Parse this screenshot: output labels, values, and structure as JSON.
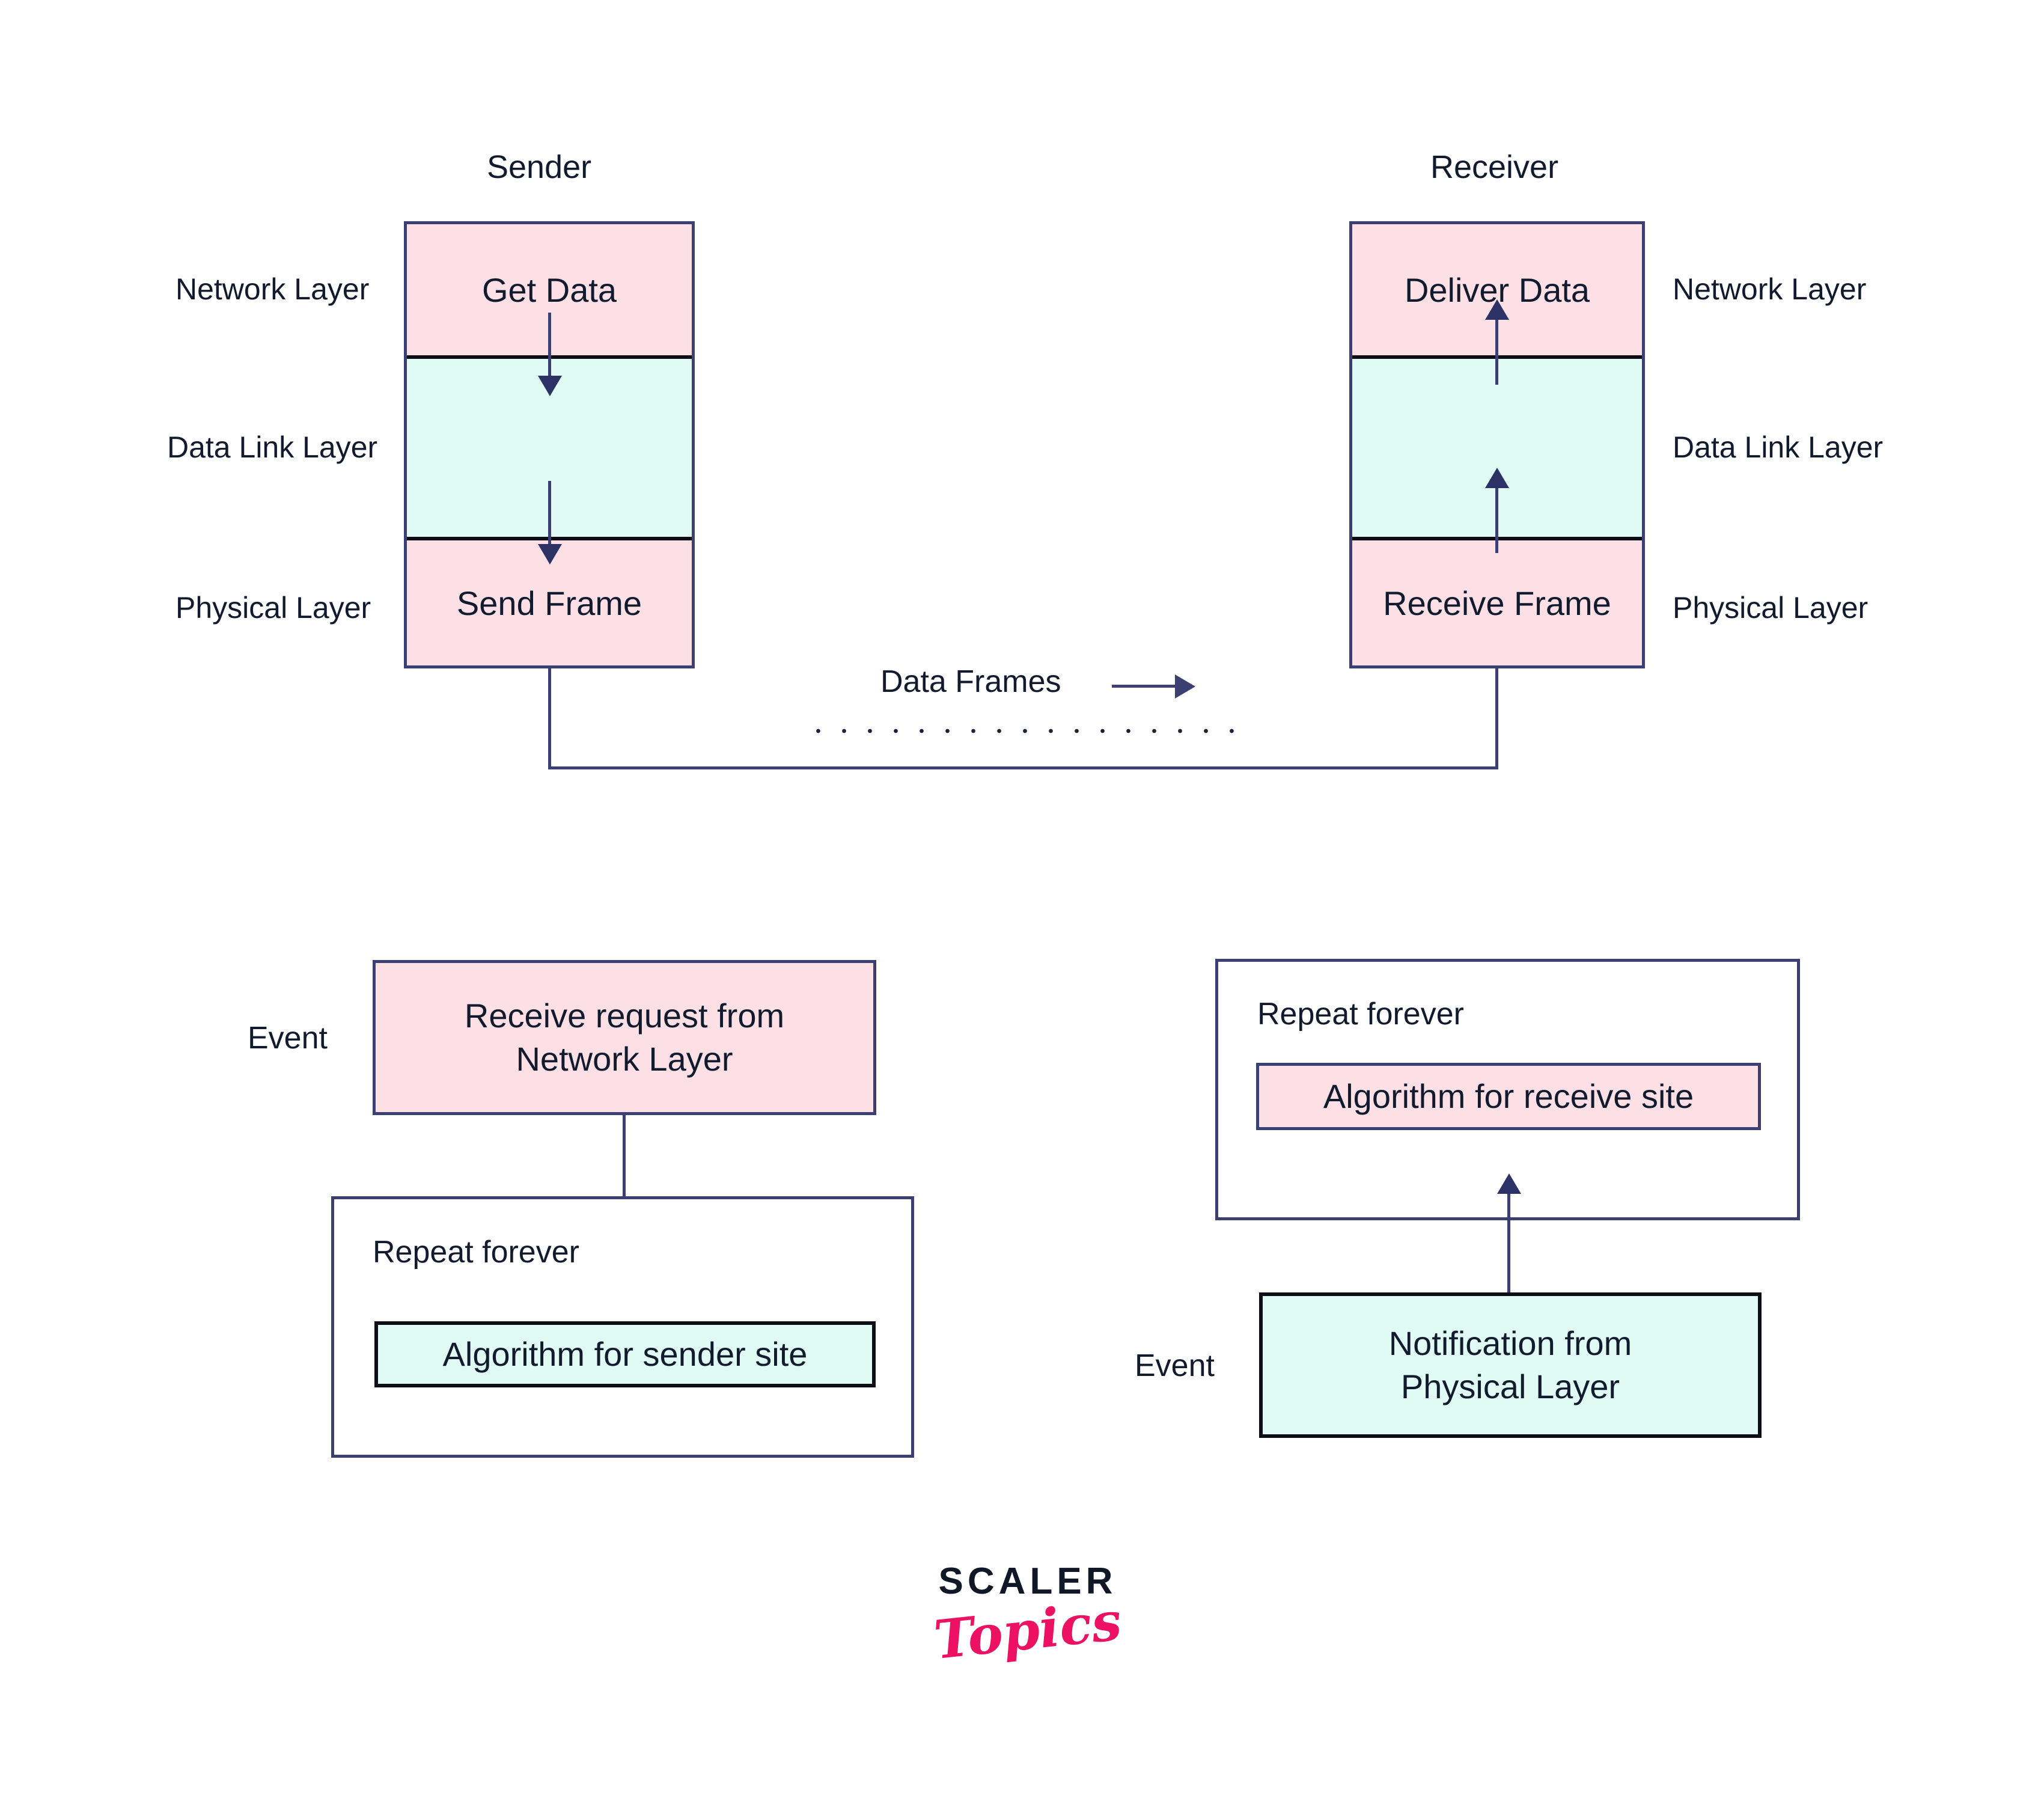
{
  "diagram": {
    "title_sender": "Sender",
    "title_receiver": "Receiver",
    "transmission_label": "Data Frames",
    "sender_stack": {
      "layers": [
        {
          "name": "Network Layer",
          "text": "Get Data",
          "fill": "#fce0e6"
        },
        {
          "name": "Data Link Layer",
          "text": "",
          "fill": "#e0fbf4"
        },
        {
          "name": "Physical Layer",
          "text": "Send Frame",
          "fill": "#fce0e6"
        }
      ]
    },
    "receiver_stack": {
      "layers": [
        {
          "name": "Network Layer",
          "text": "Deliver Data",
          "fill": "#fce0e6"
        },
        {
          "name": "Data Link Layer",
          "text": "",
          "fill": "#e0fbf4"
        },
        {
          "name": "Physical Layer",
          "text": "Receive Frame",
          "fill": "#fce0e6"
        }
      ]
    },
    "sender_flow": {
      "event_label": "Event",
      "event_box_line1": "Receive request from",
      "event_box_line2": "Network Layer",
      "repeat_label": "Repeat forever",
      "algorithm_box": "Algorithm for sender site"
    },
    "receiver_flow": {
      "event_label": "Event",
      "event_box_line1": "Notification from",
      "event_box_line2": "Physical Layer",
      "repeat_label": "Repeat forever",
      "algorithm_box": "Algorithm for receive site"
    }
  },
  "logo": {
    "word_mark": "SCALER",
    "script_mark": "Topics",
    "word_color": "#101828",
    "script_color": "#ed1164"
  },
  "colors": {
    "pink_fill": "#fce0e6",
    "mint_fill": "#e0fbf4",
    "stroke_navy": "#3b3f72",
    "stroke_black": "#0d0d18",
    "text": "#121a2e",
    "background": "#ffffff"
  }
}
